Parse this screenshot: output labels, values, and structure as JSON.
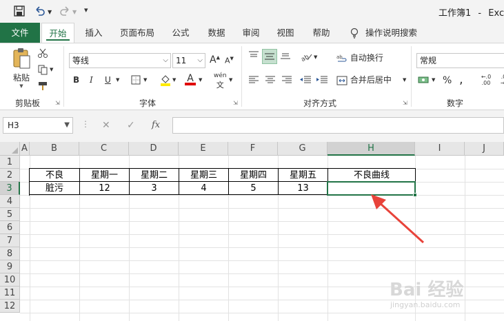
{
  "titlebar": {
    "doc_title": "工作簿1",
    "separator": "-",
    "app_name": "Excel"
  },
  "tabs": [
    {
      "label": "文件"
    },
    {
      "label": "开始"
    },
    {
      "label": "插入"
    },
    {
      "label": "页面布局"
    },
    {
      "label": "公式"
    },
    {
      "label": "数据"
    },
    {
      "label": "审阅"
    },
    {
      "label": "视图"
    },
    {
      "label": "帮助"
    },
    {
      "label": "操作说明搜索"
    }
  ],
  "ribbon": {
    "clipboard": {
      "paste_label": "粘贴",
      "group_label": "剪贴板"
    },
    "font": {
      "font_name": "等线",
      "font_size": "11",
      "bold": "B",
      "italic": "I",
      "underline": "U",
      "font_color_glyph": "A",
      "pinyin_glyph": "wén",
      "group_label": "字体"
    },
    "alignment": {
      "wrap_text": "自动换行",
      "merge_center": "合并后居中",
      "group_label": "对齐方式"
    },
    "number": {
      "format": "常规",
      "percent": "%",
      "comma": ",",
      "inc_decimal": "←.0 .00",
      "dec_decimal": ".00 →.0",
      "group_label": "数字"
    }
  },
  "formula_bar": {
    "name_box": "H3",
    "formula": ""
  },
  "grid": {
    "columns": [
      "A",
      "B",
      "C",
      "D",
      "E",
      "F",
      "G",
      "H",
      "I",
      "J"
    ],
    "rows": [
      "1",
      "2",
      "3",
      "4",
      "5",
      "6",
      "7",
      "8",
      "9",
      "10",
      "11",
      "12"
    ],
    "selected_column": "H",
    "selected_row": "3",
    "table": {
      "header": [
        "不良",
        "星期一",
        "星期二",
        "星期三",
        "星期四",
        "星期五",
        "不良曲线"
      ],
      "row": [
        "脏污",
        "12",
        "3",
        "4",
        "5",
        "13",
        ""
      ]
    }
  },
  "annotation": {
    "arrow_color": "#e8433a"
  },
  "watermark": {
    "main": "Bai 经验",
    "sub": "jingyan.baidu.com"
  },
  "colors": {
    "accent": "#217346"
  }
}
